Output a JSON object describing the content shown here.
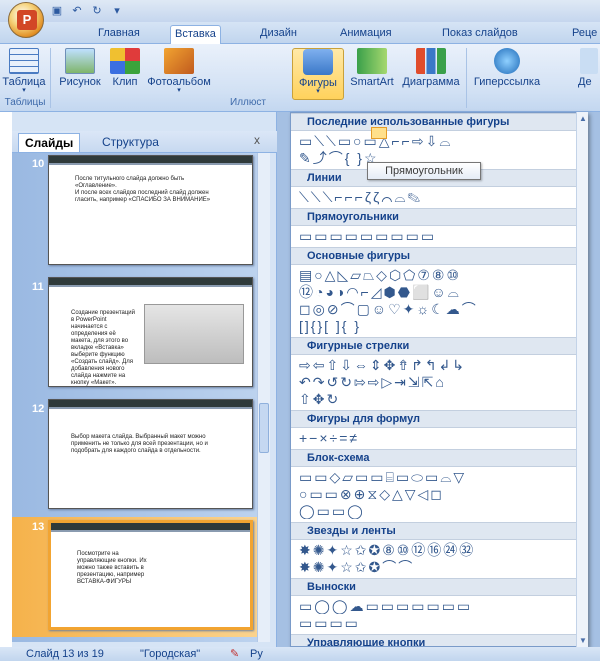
{
  "qat": {
    "save_icon": "save-icon",
    "undo_icon": "undo-icon",
    "redo_icon": "redo-icon"
  },
  "tabs": {
    "home": "Главная",
    "insert": "Вставка",
    "design": "Дизайн",
    "animation": "Анимация",
    "slideshow": "Показ слайдов",
    "review": "Реце"
  },
  "ribbon": {
    "table": "Таблица",
    "picture": "Рисунок",
    "clip": "Клип",
    "album": "Фотоальбом",
    "shapes": "Фигуры",
    "smartart": "SmartArt",
    "chart": "Диаграмма",
    "hyperlink": "Гиперссылка",
    "action": "Де",
    "group_tables": "Таблицы",
    "group_illustrations": "Иллюст"
  },
  "pane": {
    "tab_slides": "Слайды",
    "tab_outline": "Структура",
    "close": "x"
  },
  "slides": [
    {
      "num": "10",
      "text": "После титульного слайда должно быть «Оглавление».\nИ после всех слайдов последний слайд должен гласить, например «СПАСИБО ЗА ВНИМАНИЕ»"
    },
    {
      "num": "11",
      "text": "Создание презентаций в PowerPoint начинается с определения её макета, для этого во вкладке «Вставка» выберите функцию «Создать слайд». Для добавления нового слайда нажмите на кнопку «Макет»."
    },
    {
      "num": "12",
      "text": "Выбор макета слайда. Выбранный макет можно применить не только для всей презентации, но и подобрать для каждого слайда в отдельности."
    },
    {
      "num": "13",
      "text": "Посмотрите на управляющие кнопки. Их можно также вставить в презентацию, например ВСТАВКА-ФИГУРЫ"
    }
  ],
  "status": {
    "slide_info": "Слайд 13 из 19",
    "theme": "\"Городская\"",
    "lang": "Ру"
  },
  "gallery": {
    "sections": [
      {
        "title": "Последние использованные фигуры",
        "rows": [
          "▭⟍⟍▭○▭△⌐⌐⇨⇩⌓",
          "✎⤴⌒{ }☆"
        ]
      },
      {
        "title": "Линии",
        "rows": [
          "⟍⟍⟍⌐⌐⌐ζζ⌒⌓✎"
        ]
      },
      {
        "title": "Прямоугольники",
        "rows": [
          "▭▭▭▭▭▭▭▭▭"
        ]
      },
      {
        "title": "Основные фигуры",
        "rows": [
          "▤○△◺▱⏢◇⬡⬠⑦⑧⑩",
          "⑫◔◕◑◠⌐◿⬢⬣⬜☺⌓",
          "◻◎⊘⌒▢☺♡✦☼☾☁⌒",
          "[]{}[ ]{ }"
        ]
      },
      {
        "title": "Фигурные стрелки",
        "rows": [
          "⇨⇦⇧⇩⇔⇕✥⇮↱↰↲↳",
          "↶↷↺↻⇰⇨▷⇥⇲⇱⌂",
          "⇧✥↻"
        ]
      },
      {
        "title": "Фигуры для формул",
        "rows": [
          "+−×÷=≠"
        ]
      },
      {
        "title": "Блок-схема",
        "rows": [
          "▭▭◇▱▭▭⌸▭⬭▭⌓▽",
          "○▭▭⊗⊕⧖◇△▽◁◻",
          "◯▭▭◯"
        ]
      },
      {
        "title": "Звезды и ленты",
        "rows": [
          "✸✺✦☆✩✪⑧⑩⑫⑯㉔㉜",
          "✸✺✦☆✩✪⌒⌒"
        ]
      },
      {
        "title": "Выноски",
        "rows": [
          "▭◯◯☁▭▭▭▭▭▭▭",
          "▭▭▭▭"
        ]
      },
      {
        "title": "Управляющие кнопки",
        "rows": [
          "◁▷⏮⏭⌂ⓘ↩▭▭◁?▭"
        ]
      }
    ]
  },
  "tooltip": "Прямоугольник",
  "colors": {
    "accent": "#f2a431",
    "ribbon": "#d2e1f4",
    "tab_text": "#15428b"
  }
}
